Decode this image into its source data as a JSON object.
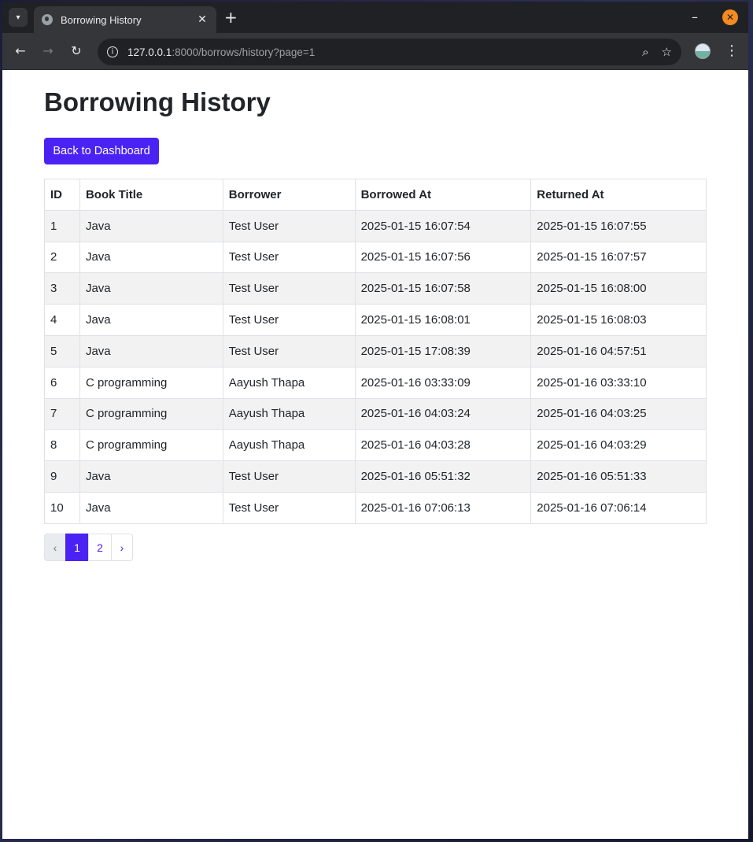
{
  "browser": {
    "tab_title": "Borrowing History",
    "url_host": "127.0.0.1",
    "url_path": ":8000/borrows/history?page=1"
  },
  "page": {
    "title": "Borrowing History",
    "back_button": "Back to Dashboard"
  },
  "table": {
    "headers": [
      "ID",
      "Book Title",
      "Borrower",
      "Borrowed At",
      "Returned At"
    ],
    "rows": [
      [
        "1",
        "Java",
        "Test User",
        "2025-01-15 16:07:54",
        "2025-01-15 16:07:55"
      ],
      [
        "2",
        "Java",
        "Test User",
        "2025-01-15 16:07:56",
        "2025-01-15 16:07:57"
      ],
      [
        "3",
        "Java",
        "Test User",
        "2025-01-15 16:07:58",
        "2025-01-15 16:08:00"
      ],
      [
        "4",
        "Java",
        "Test User",
        "2025-01-15 16:08:01",
        "2025-01-15 16:08:03"
      ],
      [
        "5",
        "Java",
        "Test User",
        "2025-01-15 17:08:39",
        "2025-01-16 04:57:51"
      ],
      [
        "6",
        "C programming",
        "Aayush Thapa",
        "2025-01-16 03:33:09",
        "2025-01-16 03:33:10"
      ],
      [
        "7",
        "C programming",
        "Aayush Thapa",
        "2025-01-16 04:03:24",
        "2025-01-16 04:03:25"
      ],
      [
        "8",
        "C programming",
        "Aayush Thapa",
        "2025-01-16 04:03:28",
        "2025-01-16 04:03:29"
      ],
      [
        "9",
        "Java",
        "Test User",
        "2025-01-16 05:51:32",
        "2025-01-16 05:51:33"
      ],
      [
        "10",
        "Java",
        "Test User",
        "2025-01-16 07:06:13",
        "2025-01-16 07:06:14"
      ]
    ]
  },
  "pagination": {
    "prev": "‹",
    "pages": [
      "1",
      "2"
    ],
    "current": "1",
    "next": "›"
  },
  "colors": {
    "accent": "#4b22f4",
    "stripe": "#f2f2f2"
  }
}
